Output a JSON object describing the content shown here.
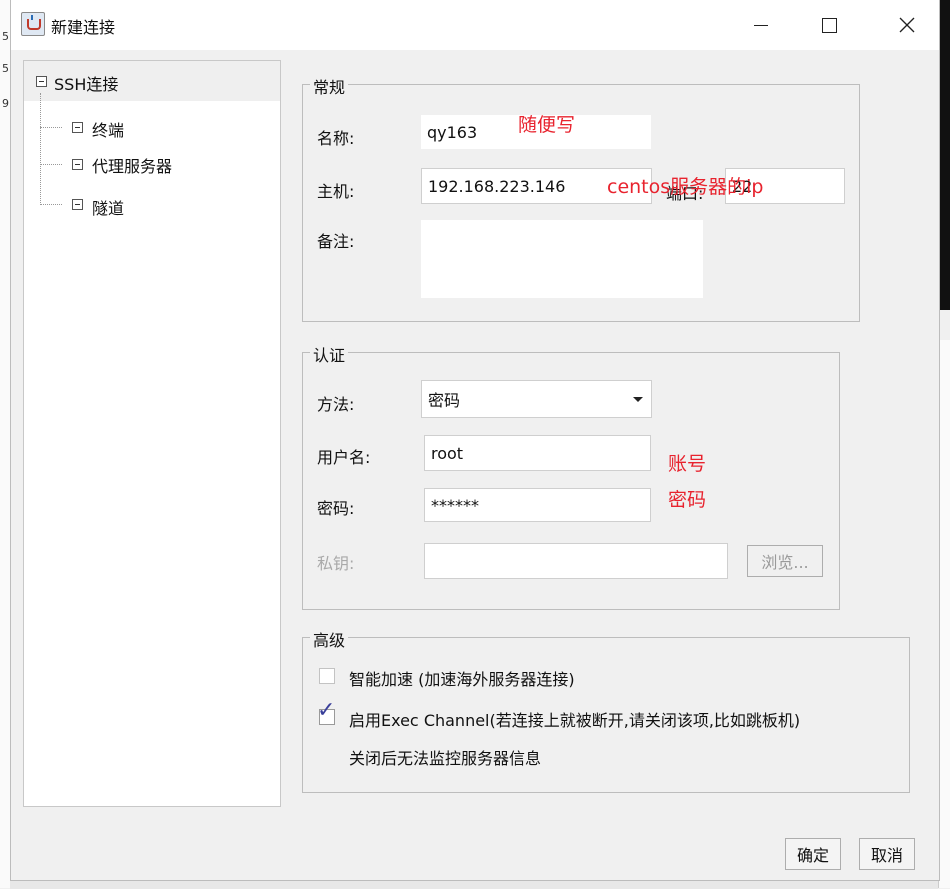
{
  "window": {
    "title": "新建连接"
  },
  "background": {
    "left_ticks": [
      "5",
      "5",
      "9"
    ]
  },
  "tree": {
    "root": "SSH连接",
    "children": [
      "终端",
      "代理服务器",
      "隧道"
    ]
  },
  "general": {
    "legend": "常规",
    "name_label": "名称:",
    "name_value": "qy163",
    "host_label": "主机:",
    "host_value": "192.168.223.146",
    "port_label": "端口:",
    "port_value": "22",
    "note_label": "备注:",
    "note_value": ""
  },
  "auth": {
    "legend": "认证",
    "method_label": "方法:",
    "method_value": "密码",
    "username_label": "用户名:",
    "username_value": "root",
    "password_label": "密码:",
    "password_value": "******",
    "key_label": "私钥:",
    "key_value": "",
    "browse_label": "浏览..."
  },
  "advanced": {
    "legend": "高级",
    "smart_accel_label": "智能加速 (加速海外服务器连接)",
    "smart_accel_checked": false,
    "exec_channel_label": "启用Exec Channel(若连接上就被断开,请关闭该项,比如跳板机)",
    "exec_channel_checked": true,
    "exec_note": "关闭后无法监控服务器信息"
  },
  "annotations": {
    "name_note": "随便写",
    "host_note": "centos服务器的ip",
    "username_note": "账号",
    "password_note": "密码"
  },
  "buttons": {
    "ok": "确定",
    "cancel": "取消"
  },
  "colors": {
    "annotation": "#e8232e",
    "checkmark": "#3a3f9a"
  }
}
